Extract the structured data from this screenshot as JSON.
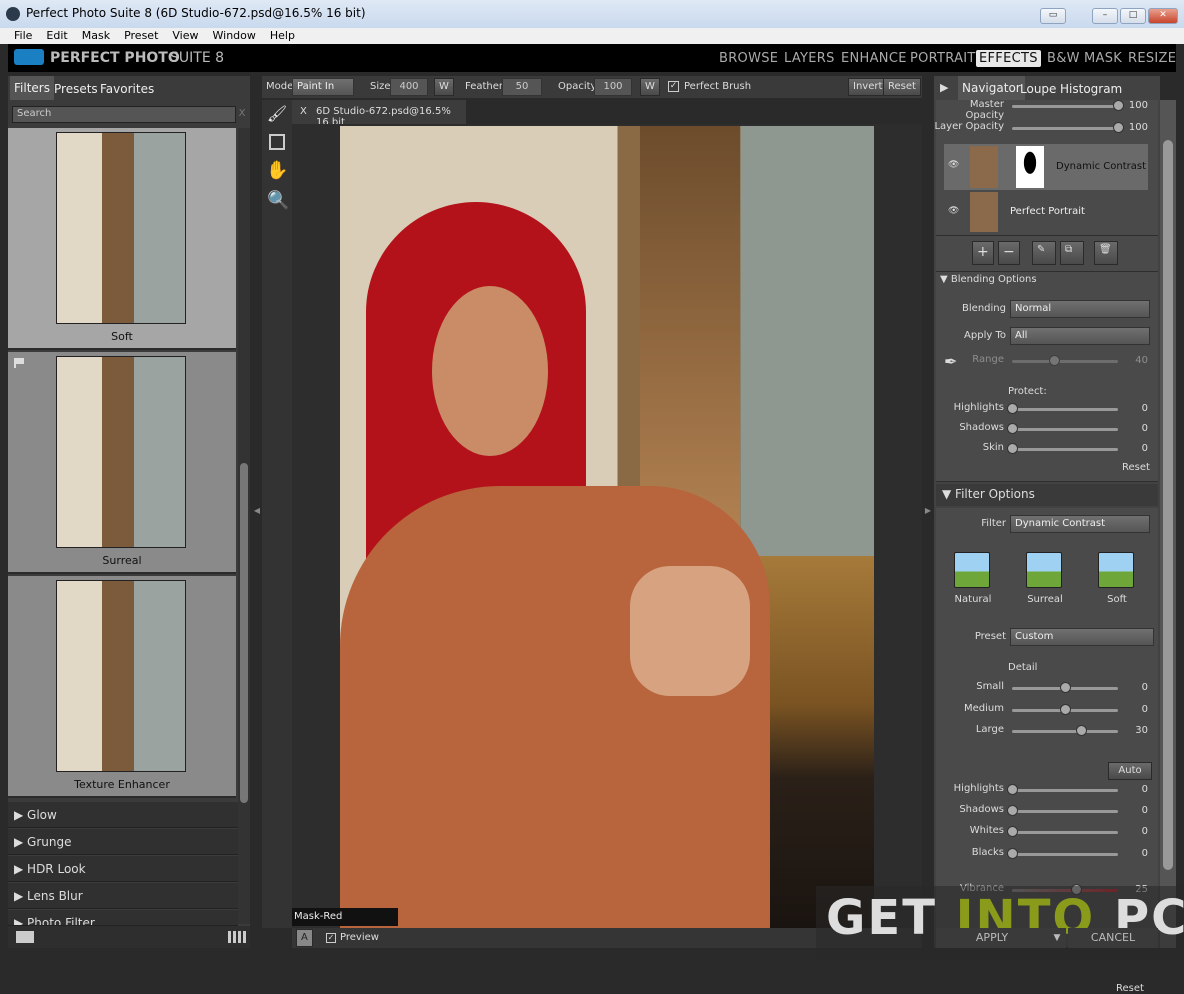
{
  "window": {
    "title": "Perfect Photo Suite 8 (6D Studio-672.psd@16.5% 16 bit)"
  },
  "menu": [
    "File",
    "Edit",
    "Mask",
    "Preset",
    "View",
    "Window",
    "Help"
  ],
  "app": {
    "logo": "on1",
    "brand": "PERFECT PHOTO",
    "brand2": "SUITE 8",
    "nav": [
      "BROWSE",
      "LAYERS",
      "ENHANCE",
      "PORTRAIT",
      "EFFECTS",
      "B&W",
      "MASK",
      "RESIZE"
    ],
    "active_nav": "EFFECTS"
  },
  "left": {
    "tabs": [
      "Filters",
      "Presets",
      "Favorites"
    ],
    "search_placeholder": "Search",
    "search_clear": "X",
    "thumbs": [
      "Soft",
      "Surreal",
      "Texture Enhancer"
    ],
    "selected": "Soft",
    "categories": [
      "Glow",
      "Grunge",
      "HDR Look",
      "Lens Blur",
      "Photo Filter"
    ]
  },
  "toolbar": {
    "mode_label": "Mode",
    "mode": "Paint In",
    "size_label": "Size",
    "size": "400",
    "w": "W",
    "feather_label": "Feather",
    "feather": "50",
    "opacity_label": "Opacity",
    "opacity": "100",
    "perfect_brush": "Perfect Brush",
    "perfect_brush_checked": true,
    "invert": "Invert",
    "reset": "Reset"
  },
  "document": {
    "tab_close": "X",
    "tab": "6D Studio-672.psd@16.5% 16 bit",
    "mask_view": "Mask-Red",
    "preview_label": "Preview",
    "preview_checked": true,
    "mask_button": "A"
  },
  "right": {
    "tabs": [
      "Navigator",
      "Loupe",
      "Histogram"
    ],
    "active_tab": "Navigator",
    "opacity": [
      {
        "label": "Master Opacity",
        "value": "100",
        "pos": 1.0
      },
      {
        "label": "Layer Opacity",
        "value": "100",
        "pos": 1.0
      }
    ],
    "layers": [
      "Dynamic Contrast",
      "Perfect Portrait"
    ],
    "blending_header": "Blending Options",
    "blending_label": "Blending",
    "blending": "Normal",
    "apply_label": "Apply To",
    "apply": "All",
    "range": {
      "label": "Range",
      "value": "40",
      "pos": 0.4
    },
    "protect_label": "Protect:",
    "protect": [
      {
        "label": "Highlights",
        "value": "0",
        "pos": 0
      },
      {
        "label": "Shadows",
        "value": "0",
        "pos": 0
      },
      {
        "label": "Skin",
        "value": "0",
        "pos": 0
      }
    ],
    "reset": "Reset",
    "filter_header": "Filter Options",
    "filter_label": "Filter",
    "filter": "Dynamic Contrast",
    "filter_presets": [
      "Natural",
      "Surreal",
      "Soft"
    ],
    "preset_label": "Preset",
    "preset": "Custom",
    "detail_label": "Detail",
    "detail": [
      {
        "label": "Small",
        "value": "0",
        "pos": 0.5
      },
      {
        "label": "Medium",
        "value": "0",
        "pos": 0.5
      },
      {
        "label": "Large",
        "value": "30",
        "pos": 0.65
      }
    ],
    "auto": "Auto",
    "tone": [
      {
        "label": "Highlights",
        "value": "0",
        "pos": 0
      },
      {
        "label": "Shadows",
        "value": "0",
        "pos": 0
      },
      {
        "label": "Whites",
        "value": "0",
        "pos": 0
      },
      {
        "label": "Blacks",
        "value": "0",
        "pos": 0
      }
    ],
    "vibrance": {
      "label": "Vibrance",
      "value": "25",
      "pos": 0.6
    },
    "reset2": "Reset",
    "apply_btn": "APPLY",
    "cancel_btn": "CANCEL"
  },
  "watermark": {
    "text1": "GET",
    "text2": "INTO",
    "text3": "PC"
  }
}
